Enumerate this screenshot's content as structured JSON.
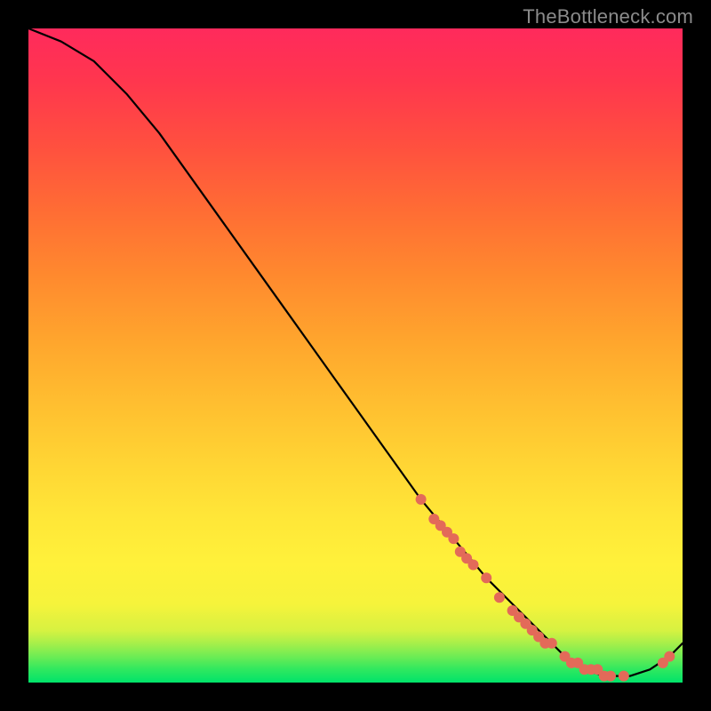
{
  "watermark": "TheBottleneck.com",
  "chart_data": {
    "type": "line",
    "title": "",
    "xlabel": "",
    "ylabel": "",
    "xlim": [
      0,
      100
    ],
    "ylim": [
      0,
      100
    ],
    "grid": false,
    "legend": false,
    "series": [
      {
        "name": "bottleneck-curve",
        "x": [
          0,
          5,
          10,
          12,
          15,
          20,
          25,
          30,
          35,
          40,
          45,
          50,
          55,
          60,
          65,
          70,
          75,
          80,
          83,
          85,
          88,
          90,
          92,
          95,
          98,
          100
        ],
        "y": [
          100,
          98,
          95,
          93,
          90,
          84,
          77,
          70,
          63,
          56,
          49,
          42,
          35,
          28,
          22,
          16,
          11,
          6,
          3,
          2,
          1,
          1,
          1,
          2,
          4,
          6
        ]
      }
    ],
    "points": {
      "name": "sample-markers",
      "x": [
        60,
        62,
        63,
        64,
        65,
        66,
        67,
        68,
        70,
        72,
        74,
        75,
        76,
        77,
        78,
        79,
        80,
        82,
        83,
        84,
        85,
        86,
        87,
        88,
        89,
        91,
        97,
        98
      ],
      "y": [
        28,
        25,
        24,
        23,
        22,
        20,
        19,
        18,
        16,
        13,
        11,
        10,
        9,
        8,
        7,
        6,
        6,
        4,
        3,
        3,
        2,
        2,
        2,
        1,
        1,
        1,
        3,
        4
      ]
    },
    "colors": {
      "curve": "#000000",
      "points": "#e36a59",
      "gradient_top": "#ff2a5c",
      "gradient_mid": "#ffe738",
      "gradient_bottom": "#00e36a"
    }
  }
}
